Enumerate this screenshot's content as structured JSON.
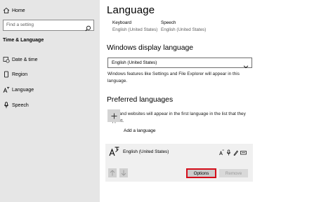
{
  "sidebar": {
    "home_label": "Home",
    "search_placeholder": "Find a setting",
    "section_title": "Time & Language",
    "items": [
      {
        "label": "Date & time",
        "icon": "calendar-clock-icon"
      },
      {
        "label": "Region",
        "icon": "globe-icon"
      },
      {
        "label": "Language",
        "icon": "language-icon"
      },
      {
        "label": "Speech",
        "icon": "microphone-icon"
      }
    ]
  },
  "main": {
    "title": "Language",
    "quick_links": [
      {
        "heading": "Keyboard",
        "value": "English (United States)"
      },
      {
        "heading": "Speech",
        "value": "English (United States)"
      }
    ],
    "display_language": {
      "heading": "Windows display language",
      "selected": "English (United States)",
      "note": "Windows features like Settings and File Explorer will appear in this language."
    },
    "preferred": {
      "heading": "Preferred languages",
      "note": "Apps and websites will appear in the first language in the list that they support.",
      "add_label": "Add a language",
      "languages": [
        {
          "name": "English (United States)",
          "features": [
            "display-language-icon",
            "speech-icon",
            "handwriting-icon",
            "keyboard-icon"
          ]
        }
      ],
      "options_label": "Options",
      "remove_label": "Remove"
    }
  },
  "colors": {
    "sidebar_bg": "#e6e6e6",
    "highlight_border": "#d40d1a",
    "button_bg": "#cccccc"
  }
}
